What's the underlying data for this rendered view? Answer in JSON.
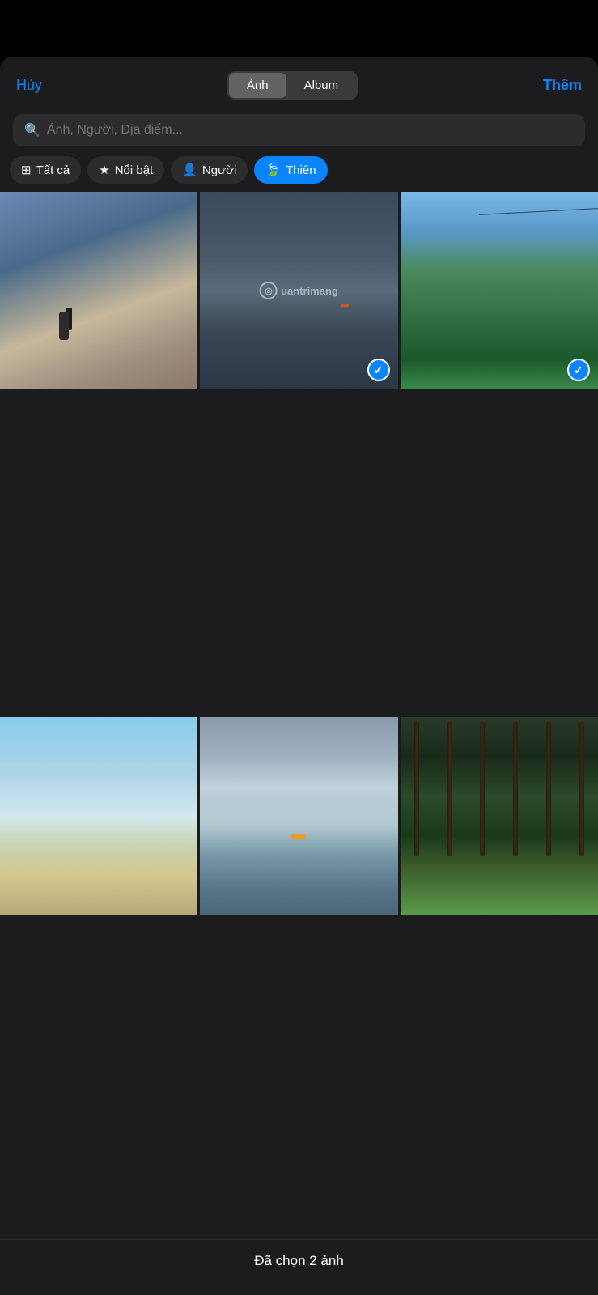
{
  "header": {
    "cancel_label": "Hủy",
    "add_label": "Thêm",
    "segment": {
      "photo_label": "Ảnh",
      "album_label": "Album",
      "active": "photo"
    }
  },
  "search": {
    "placeholder": "Ảnh, Người, Địa điểm..."
  },
  "filters": [
    {
      "id": "all",
      "label": "Tất cả",
      "icon": "grid",
      "active": false
    },
    {
      "id": "featured",
      "label": "Nổi bật",
      "icon": "star",
      "active": false
    },
    {
      "id": "people",
      "label": "Người",
      "icon": "person",
      "active": false
    },
    {
      "id": "nature",
      "label": "Thiên",
      "icon": "leaf",
      "active": true
    }
  ],
  "photos": [
    {
      "id": 1,
      "selected": false,
      "alt": "Beach with person silhouette"
    },
    {
      "id": 2,
      "selected": true,
      "alt": "Dark cloudy sea"
    },
    {
      "id": 3,
      "selected": true,
      "alt": "Green mountain with cable"
    },
    {
      "id": 4,
      "selected": false,
      "alt": "Sandy beach shore"
    },
    {
      "id": 5,
      "selected": false,
      "alt": "Cloudy sky over sea with boat"
    },
    {
      "id": 6,
      "selected": false,
      "alt": "Pine forest"
    }
  ],
  "watermark": {
    "icon": "◎",
    "text": "uantrimang"
  },
  "bottom_bar": {
    "status_text": "Đã chọn 2 ảnh"
  }
}
